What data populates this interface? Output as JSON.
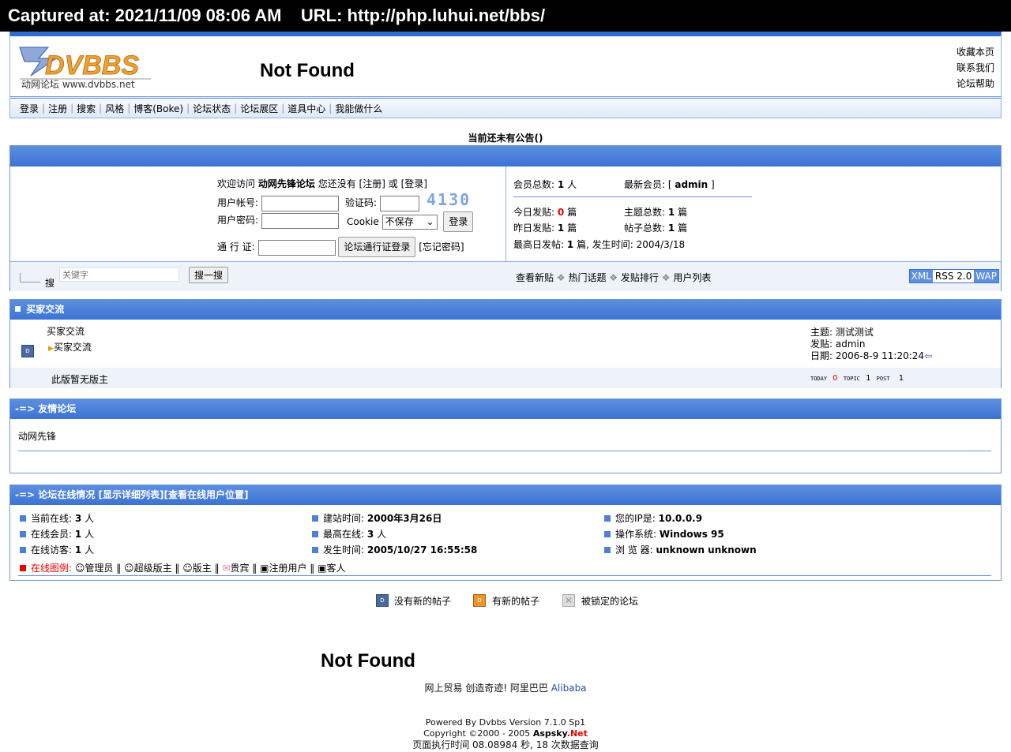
{
  "capture": {
    "text": "Captured at: 2021/11/09 08:06 AM    URL: http://php.luhui.net/bbs/"
  },
  "header": {
    "logo_text": "DVBBS",
    "logo_sub": "动网论坛 www.dvbbs.net",
    "title": "Not Found",
    "links": [
      "收藏本页",
      "联系我们",
      "论坛帮助"
    ]
  },
  "nav": {
    "items": [
      "登录",
      "注册",
      "搜索",
      "风格",
      "博客(Boke)",
      "论坛状态",
      "论坛展区",
      "道具中心",
      "我能做什么"
    ]
  },
  "notice": "当前还未有公告()",
  "login": {
    "welcome_prefix": "欢迎访问",
    "forum_name": "动网先锋论坛",
    "welcome_mid": "您还没有",
    "register_link": "[注册]",
    "or": "或",
    "login_link": "[登录]",
    "username_label": "用户帐号:",
    "captcha_label": "验证码:",
    "captcha_code": "4130",
    "password_label": "用户密码:",
    "cookie_label": "Cookie",
    "cookie_value": "不保存",
    "login_button": "登录",
    "passport_label": "通 行 证:",
    "passport_button": "论坛通行证登录",
    "forgot_link": "[忘记密码]"
  },
  "stats": {
    "members_label": "会员总数:",
    "members_value": "1",
    "members_unit": "人",
    "newest_label": "最新会员:",
    "newest_value": "admin",
    "today_label": "今日发贴:",
    "today_value": "0",
    "today_unit": "篇",
    "topics_label": "主题总数:",
    "topics_value": "1",
    "topics_unit": "篇",
    "yesterday_label": "昨日发贴:",
    "yesterday_value": "1",
    "yesterday_unit": "篇",
    "posts_label": "帖子总数:",
    "posts_value": "1",
    "posts_unit": "篇",
    "max_label": "最高日发帖:",
    "max_value": "1",
    "max_unit": "篇,",
    "max_time_label": "发生时间:",
    "max_time_value": "2004/3/18"
  },
  "search": {
    "icon_label": "搜",
    "placeholder": "关键字",
    "button": "搜一搜",
    "links": [
      "查看新贴",
      "热门话题",
      "发贴排行",
      "用户列表"
    ],
    "badges": [
      "XML",
      "RSS 2.0",
      "WAP"
    ]
  },
  "board": {
    "category": "买家交流",
    "name": "买家交流",
    "desc": "买家交流",
    "moderator": "此版暂无版主",
    "last_topic_label": "主题:",
    "last_topic": "测试测试",
    "last_poster_label": "发贴:",
    "last_poster": "admin",
    "last_date_label": "日期:",
    "last_date": "2006-8-9 11:20:24",
    "today_label": "TODAY",
    "today_value": "0",
    "topic_label": "TOPIC",
    "topic_value": "1",
    "post_label": "POST",
    "post_value": "1"
  },
  "friends": {
    "title": "-=> 友情论坛",
    "link": "动网先锋"
  },
  "online": {
    "title_prefix": "-=> 论坛在线情况",
    "detail_link": "[显示详细列表]",
    "position_link": "[查看在线用户位置]",
    "col1": [
      {
        "label": "当前在线:",
        "value": "3",
        "unit": "人"
      },
      {
        "label": "在线会员:",
        "value": "1",
        "unit": "人"
      },
      {
        "label": "在线访客:",
        "value": "1",
        "unit": "人"
      }
    ],
    "col2": [
      {
        "label": "建站时间:",
        "value": "2000年3月26日",
        "unit": ""
      },
      {
        "label": "最高在线:",
        "value": "3",
        "unit": "人"
      },
      {
        "label": "发生时间:",
        "value": "2005/10/27 16:55:58",
        "unit": ""
      }
    ],
    "col3": [
      {
        "label": "您的IP是:",
        "value": "10.0.0.9",
        "unit": ""
      },
      {
        "label": "操作系统:",
        "value": "Windows 95",
        "unit": ""
      },
      {
        "label": "浏 览 器:",
        "value": "unknown unknown",
        "unit": ""
      }
    ],
    "legend_label": "在线图例:",
    "legend": [
      "管理员",
      "超级版主",
      "版主",
      "贵宾",
      "注册用户",
      "客人"
    ]
  },
  "legend_bottom": [
    "没有新的帖子",
    "有新的帖子",
    "被锁定的论坛"
  ],
  "footer": {
    "not_found": "Not Found",
    "slogan": "网上贸易 创造奇迹! 阿里巴巴",
    "slogan_link": "Alibaba",
    "powered": "Powered By Dvbbs Version 7.1.0 Sp1",
    "copyright": "Copyright ©2000 - 2005",
    "brand_a": "Aspsky",
    "brand_b": ".Net",
    "exec": "页面执行时间 08.08984 秒, 18 次数据查询"
  },
  "colors": {
    "accent_blue": "#3c73d3",
    "highlight_red": "#e00000",
    "brand_orange": "#f0a030"
  }
}
